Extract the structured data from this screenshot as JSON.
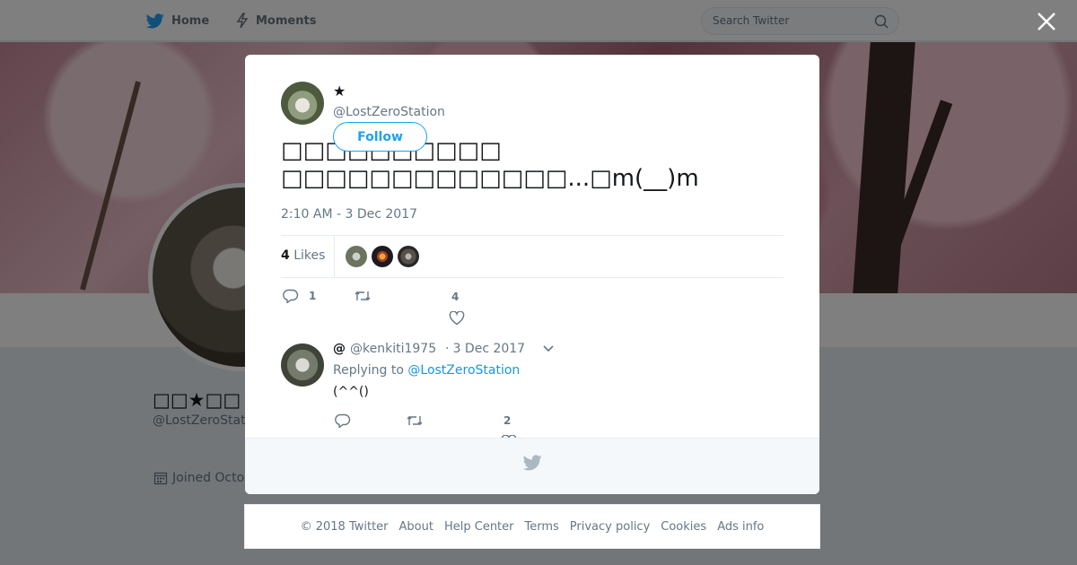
{
  "nav": {
    "home_label": "Home",
    "moments_label": "Moments",
    "search_placeholder": "Search Twitter"
  },
  "profile": {
    "name": "□□★□□",
    "handle": "@LostZeroStat",
    "joined": "Joined Octo"
  },
  "tweet": {
    "author_name": "★",
    "author_handle": "@LostZeroStation",
    "follow_label": "Follow",
    "text": "□□□□□□□□□□\n□□□□□□□□□□□□□...□m(__)m",
    "date": "2:10 AM - 3 Dec 2017",
    "likes_count": "4",
    "likes_label": "Likes",
    "replies_count": "1",
    "like_action_count": "4"
  },
  "reply": {
    "name": "@",
    "handle": "@kenkiti1975",
    "separator": "·",
    "date": "3 Dec 2017",
    "replying_prefix": "Replying to",
    "replying_handle": "@LostZeroStation",
    "text": "(^^()",
    "like_count": "2"
  },
  "footer": {
    "links": [
      "© 2018 Twitter",
      "About",
      "Help Center",
      "Terms",
      "Privacy policy",
      "Cookies",
      "Ads info"
    ]
  },
  "colors": {
    "accent": "#1da1f2",
    "link": "#1b95e0",
    "text_secondary": "#657786"
  }
}
